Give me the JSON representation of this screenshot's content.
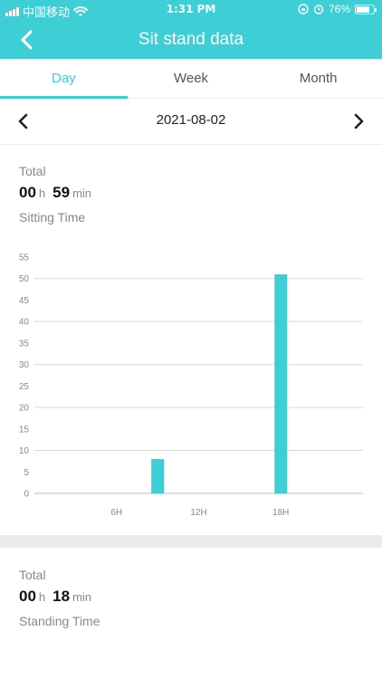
{
  "status_bar": {
    "carrier": "中国移动",
    "time": "1:31 PM",
    "battery": "76%",
    "battery_level": 0.76
  },
  "header": {
    "title": "Sit stand data",
    "back_icon": "chevron-left-icon"
  },
  "tabs": [
    {
      "label": "Day",
      "active": true
    },
    {
      "label": "Week",
      "active": false
    },
    {
      "label": "Month",
      "active": false
    }
  ],
  "date_nav": {
    "date": "2021-08-02",
    "prev_icon": "chevron-left-icon",
    "next_icon": "chevron-right-icon"
  },
  "sitting": {
    "total_label": "Total",
    "hours": "00",
    "hours_unit": "h",
    "minutes": "59",
    "minutes_unit": "min",
    "caption": "Sitting Time"
  },
  "standing": {
    "total_label": "Total",
    "hours": "00",
    "hours_unit": "h",
    "minutes": "18",
    "minutes_unit": "min",
    "caption": "Standing Time"
  },
  "colors": {
    "accent": "#3dcfd5",
    "bar": "#3dcfd5"
  },
  "chart_data": {
    "type": "bar",
    "x_ticks": [
      "6H",
      "12H",
      "18H"
    ],
    "x_tick_hours": [
      6,
      12,
      18
    ],
    "x_range_hours": [
      0,
      24
    ],
    "bars": [
      {
        "hour": 9,
        "value": 8
      },
      {
        "hour": 18,
        "value": 51
      }
    ],
    "y_ticks": [
      0,
      5,
      10,
      15,
      20,
      25,
      30,
      35,
      40,
      45,
      50,
      55
    ],
    "ylim": [
      0,
      55
    ],
    "grid": true
  }
}
